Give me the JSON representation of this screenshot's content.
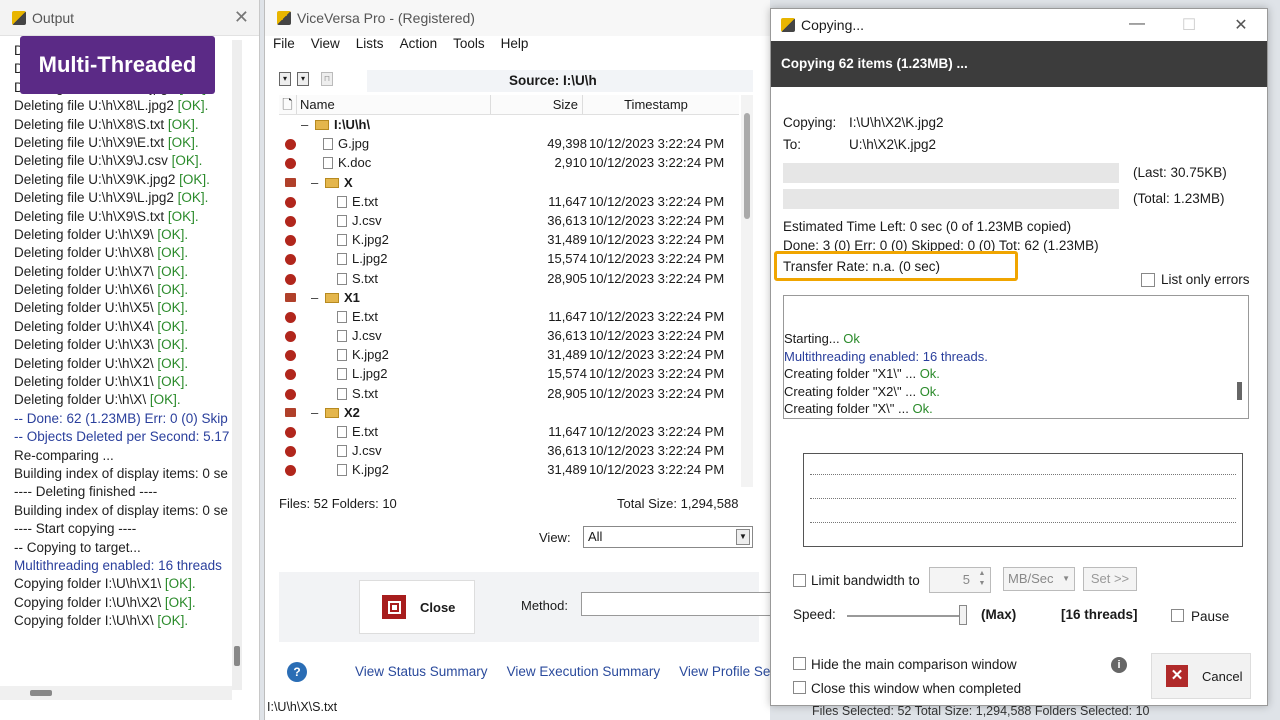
{
  "badge": "Multi-Threaded",
  "output": {
    "title": "Output",
    "log": [
      {
        "t": "Deleting file U:\\h\\X8\\E.txt ",
        "s": "[OK]."
      },
      {
        "t": "Deleting file U:\\h\\X8\\J.csv ",
        "s": "[OK]."
      },
      {
        "t": "Deleting file U:\\h\\X8\\K.jpg2 ",
        "s": "[OK]."
      },
      {
        "t": "Deleting file U:\\h\\X8\\L.jpg2 ",
        "s": "[OK]."
      },
      {
        "t": "Deleting file U:\\h\\X8\\S.txt ",
        "s": "[OK]."
      },
      {
        "t": "Deleting file U:\\h\\X9\\E.txt ",
        "s": "[OK]."
      },
      {
        "t": "Deleting file U:\\h\\X9\\J.csv ",
        "s": "[OK]."
      },
      {
        "t": "Deleting file U:\\h\\X9\\K.jpg2 ",
        "s": "[OK]."
      },
      {
        "t": "Deleting file U:\\h\\X9\\L.jpg2 ",
        "s": "[OK]."
      },
      {
        "t": "Deleting file U:\\h\\X9\\S.txt ",
        "s": "[OK]."
      },
      {
        "t": "Deleting folder U:\\h\\X9\\ ",
        "s": "[OK]."
      },
      {
        "t": "Deleting folder U:\\h\\X8\\ ",
        "s": "[OK]."
      },
      {
        "t": "Deleting folder U:\\h\\X7\\ ",
        "s": "[OK]."
      },
      {
        "t": "Deleting folder U:\\h\\X6\\ ",
        "s": "[OK]."
      },
      {
        "t": "Deleting folder U:\\h\\X5\\ ",
        "s": "[OK]."
      },
      {
        "t": "Deleting folder U:\\h\\X4\\ ",
        "s": "[OK]."
      },
      {
        "t": "Deleting folder U:\\h\\X3\\ ",
        "s": "[OK]."
      },
      {
        "t": "Deleting folder U:\\h\\X2\\ ",
        "s": "[OK]."
      },
      {
        "t": "Deleting folder U:\\h\\X1\\ ",
        "s": "[OK]."
      },
      {
        "t": "Deleting folder U:\\h\\X\\ ",
        "s": "[OK]."
      },
      {
        "t": "-- Done: 62 (1.23MB)   Err: 0 (0)   Skip",
        "s": "",
        "c": "blue"
      },
      {
        "t": "-- Objects Deleted per Second: 5.17",
        "s": "",
        "c": "blue"
      },
      {
        "t": "Re-comparing ...",
        "s": ""
      },
      {
        "t": "Building index of display items: 0 se",
        "s": ""
      },
      {
        "t": "---- Deleting finished ----",
        "s": ""
      },
      {
        "t": "Building index of display items: 0 se",
        "s": ""
      },
      {
        "t": "---- Start copying ----",
        "s": ""
      },
      {
        "t": "-- Copying to target...",
        "s": ""
      },
      {
        "t": "Multithreading enabled: 16 threads",
        "s": "",
        "c": "blue"
      },
      {
        "t": "Copying folder I:\\U\\h\\X1\\ ",
        "s": "[OK]."
      },
      {
        "t": "Copying folder I:\\U\\h\\X2\\ ",
        "s": "[OK]."
      },
      {
        "t": "Copying folder I:\\U\\h\\X\\ ",
        "s": "[OK]."
      }
    ]
  },
  "vv": {
    "title": "ViceVersa Pro - (Registered)",
    "menu": [
      "File",
      "View",
      "Lists",
      "Action",
      "Tools",
      "Help"
    ],
    "source": "Source: I:\\U\\h",
    "cols": {
      "name": "Name",
      "size": "Size",
      "ts": "Timestamp"
    },
    "rows": [
      {
        "k": "root",
        "n": "I:\\U\\h\\"
      },
      {
        "k": "file",
        "n": "G.jpg",
        "s": "49,398",
        "d": "10/12/2023 3:22:24 PM",
        "lvl": 1
      },
      {
        "k": "file",
        "n": "K.doc",
        "s": "2,910",
        "d": "10/12/2023 3:22:24 PM",
        "lvl": 1
      },
      {
        "k": "dir",
        "n": "X"
      },
      {
        "k": "file",
        "n": "E.txt",
        "s": "11,647",
        "d": "10/12/2023 3:22:24 PM",
        "lvl": 2
      },
      {
        "k": "file",
        "n": "J.csv",
        "s": "36,613",
        "d": "10/12/2023 3:22:24 PM",
        "lvl": 2
      },
      {
        "k": "file",
        "n": "K.jpg2",
        "s": "31,489",
        "d": "10/12/2023 3:22:24 PM",
        "lvl": 2
      },
      {
        "k": "file",
        "n": "L.jpg2",
        "s": "15,574",
        "d": "10/12/2023 3:22:24 PM",
        "lvl": 2
      },
      {
        "k": "file",
        "n": "S.txt",
        "s": "28,905",
        "d": "10/12/2023 3:22:24 PM",
        "lvl": 2
      },
      {
        "k": "dir",
        "n": "X1"
      },
      {
        "k": "file",
        "n": "E.txt",
        "s": "11,647",
        "d": "10/12/2023 3:22:24 PM",
        "lvl": 2
      },
      {
        "k": "file",
        "n": "J.csv",
        "s": "36,613",
        "d": "10/12/2023 3:22:24 PM",
        "lvl": 2
      },
      {
        "k": "file",
        "n": "K.jpg2",
        "s": "31,489",
        "d": "10/12/2023 3:22:24 PM",
        "lvl": 2
      },
      {
        "k": "file",
        "n": "L.jpg2",
        "s": "15,574",
        "d": "10/12/2023 3:22:24 PM",
        "lvl": 2
      },
      {
        "k": "file",
        "n": "S.txt",
        "s": "28,905",
        "d": "10/12/2023 3:22:24 PM",
        "lvl": 2
      },
      {
        "k": "dir",
        "n": "X2"
      },
      {
        "k": "file",
        "n": "E.txt",
        "s": "11,647",
        "d": "10/12/2023 3:22:24 PM",
        "lvl": 2
      },
      {
        "k": "file",
        "n": "J.csv",
        "s": "36,613",
        "d": "10/12/2023 3:22:24 PM",
        "lvl": 2
      },
      {
        "k": "file",
        "n": "K.jpg2",
        "s": "31,489",
        "d": "10/12/2023 3:22:24 PM",
        "lvl": 2
      }
    ],
    "files": "Files: 52  Folders: 10",
    "total": "Total Size: 1,294,588",
    "view_label": "View:",
    "view_value": "All",
    "close": "Close",
    "method": "Method:",
    "links": [
      "View Status Summary",
      "View Execution Summary",
      "View Profile Settin"
    ],
    "status": "I:\\U\\h\\X\\S.txt",
    "bg_status": "Files Selected: 52   Total Size: 1,294,588   Folders Selected: 10"
  },
  "copy": {
    "title": "Copying...",
    "header": "Copying 62 items (1.23MB) ...",
    "copying_label": "Copying:",
    "copying_value": "I:\\U\\h\\X2\\K.jpg2",
    "to_label": "To:",
    "to_value": "U:\\h\\X2\\K.jpg2",
    "last": "(Last: 30.75KB)",
    "total": "(Total: 1.23MB)",
    "eta": "Estimated Time Left: 0 sec (0 of 1.23MB copied)",
    "done": "Done: 3 (0)  Err: 0 (0)  Skipped: 0 (0)  Tot: 62 (1.23MB)",
    "rate": "Transfer Rate: n.a. (0 sec)",
    "list_errors": "List only errors",
    "log": [
      {
        "t": "Starting... ",
        "s": "Ok"
      },
      {
        "t": "Multithreading enabled: 16 threads.",
        "s": "",
        "c": "blue"
      },
      {
        "t": "Creating folder \"X1\\\" ... ",
        "s": "Ok."
      },
      {
        "t": "Creating folder \"X2\\\" ... ",
        "s": "Ok."
      },
      {
        "t": "Creating folder \"X\\\" ... ",
        "s": "Ok."
      }
    ],
    "limit_bw": "Limit bandwidth to",
    "bw_value": "5",
    "bw_unit": "MB/Sec",
    "set": "Set >>",
    "speed": "Speed:",
    "max": "(Max)",
    "threads": "[16 threads]",
    "pause": "Pause",
    "hide_main": "Hide the main comparison window",
    "close_when": "Close this window when completed",
    "cancel": "Cancel"
  },
  "colors": {
    "badge": "#5b2a86",
    "highlight": "#f0a500",
    "ok": "#2a8a2a",
    "blue": "#2a3f9c"
  }
}
